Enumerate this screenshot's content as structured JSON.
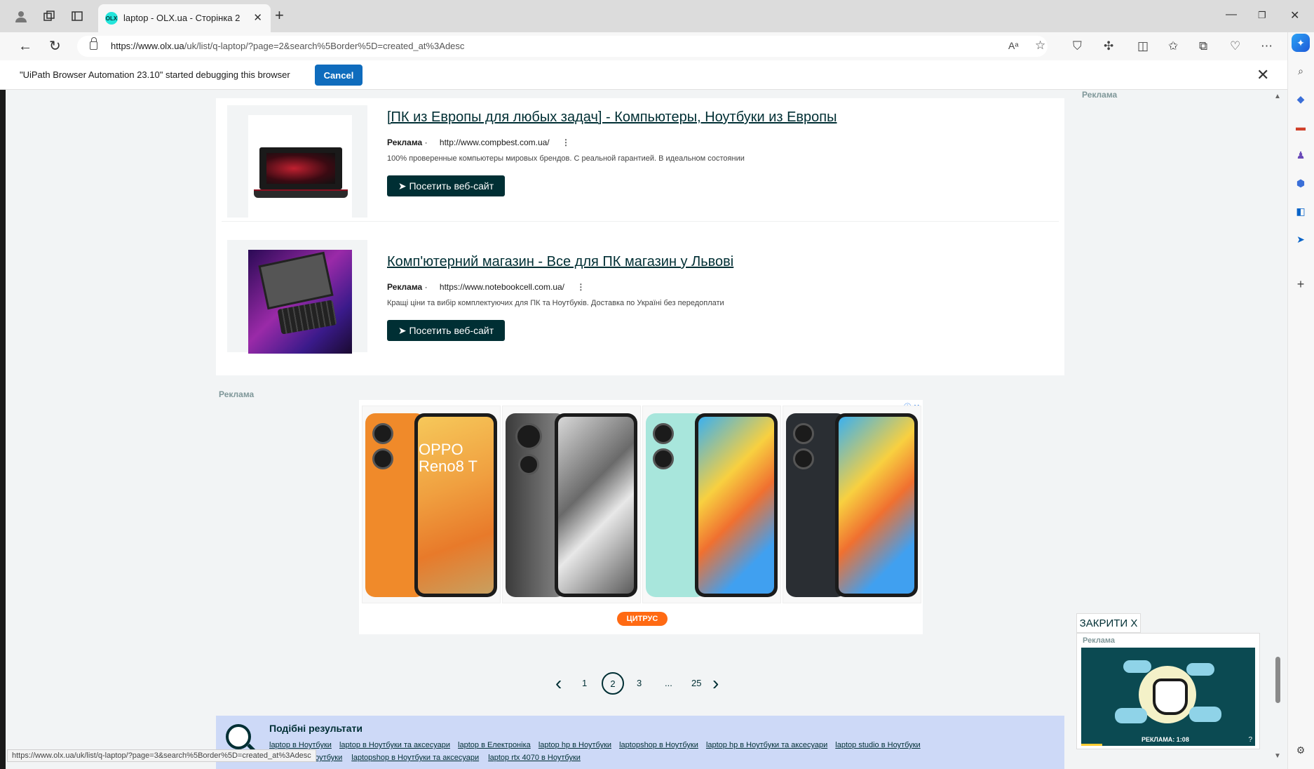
{
  "browser": {
    "tab_title": "laptop - OLX.ua - Сторінка 2",
    "tab_favicon": "olx",
    "url_host": "https://www.olx.ua",
    "url_rest": "/uk/list/q-laptop/?page=2&search%5Border%5D=created_at%3Adesc",
    "infobar_text": "\"UiPath Browser Automation 23.10\" started debugging this browser",
    "cancel_label": "Cancel"
  },
  "page": {
    "ad_label_right": "Реклама",
    "ad_label_mid": "Реклама",
    "ads": [
      {
        "title": "[ПК из Европы для любых задач] - Компьютеры, Ноутбуки из Европы",
        "label": "Реклама",
        "site": "http://www.compbest.com.ua/",
        "desc": "100% проверенные компьютеры мировых брендов. С реальной гарантией. В идеальном состоянии",
        "button": "➤ Посетить веб-сайт"
      },
      {
        "title": "Комп'ютерний магазин - Все для ПК магазин у Львові",
        "label": "Реклама",
        "site": "https://www.notebookcell.com.ua/",
        "desc": "Кращі ціни та вибір комплектуючих для ПК та Ноутбуків. Доставка по Україні без передоплати",
        "button": "➤ Посетить веб-сайт"
      }
    ],
    "banner": {
      "phone_text_line1": "OPPO",
      "phone_text_line2": "Reno8 T",
      "brand_badge": "ЦИТРУС"
    },
    "pagination": {
      "pages": [
        "1",
        "2",
        "3",
        "...",
        "25"
      ],
      "current": "2"
    },
    "similar": {
      "title": "Подібні результати",
      "links": [
        "laptop в Ноутбуки",
        "laptop в Ноутбуки та аксесуари",
        "laptop в Електроніка",
        "laptop hp в Ноутбуки",
        "laptopshop в Ноутбуки",
        "laptop hp в Ноутбуки та аксесуари",
        "laptop studio в Ноутбуки"
      ],
      "links_row2": [
        "laptop hp в Ноутбуки",
        "laptopshop в Ноутбуки та аксесуари",
        "laptop rtx 4070 в Ноутбуки"
      ]
    },
    "status_url": "https://www.olx.ua/uk/list/q-laptop/?page=3&search%5Border%5D=created_at%3Adesc",
    "video_ad": {
      "close_label": "ЗАКРИТИ X",
      "label": "Реклама",
      "caption": "РЕКЛАМА: 1:08"
    }
  }
}
